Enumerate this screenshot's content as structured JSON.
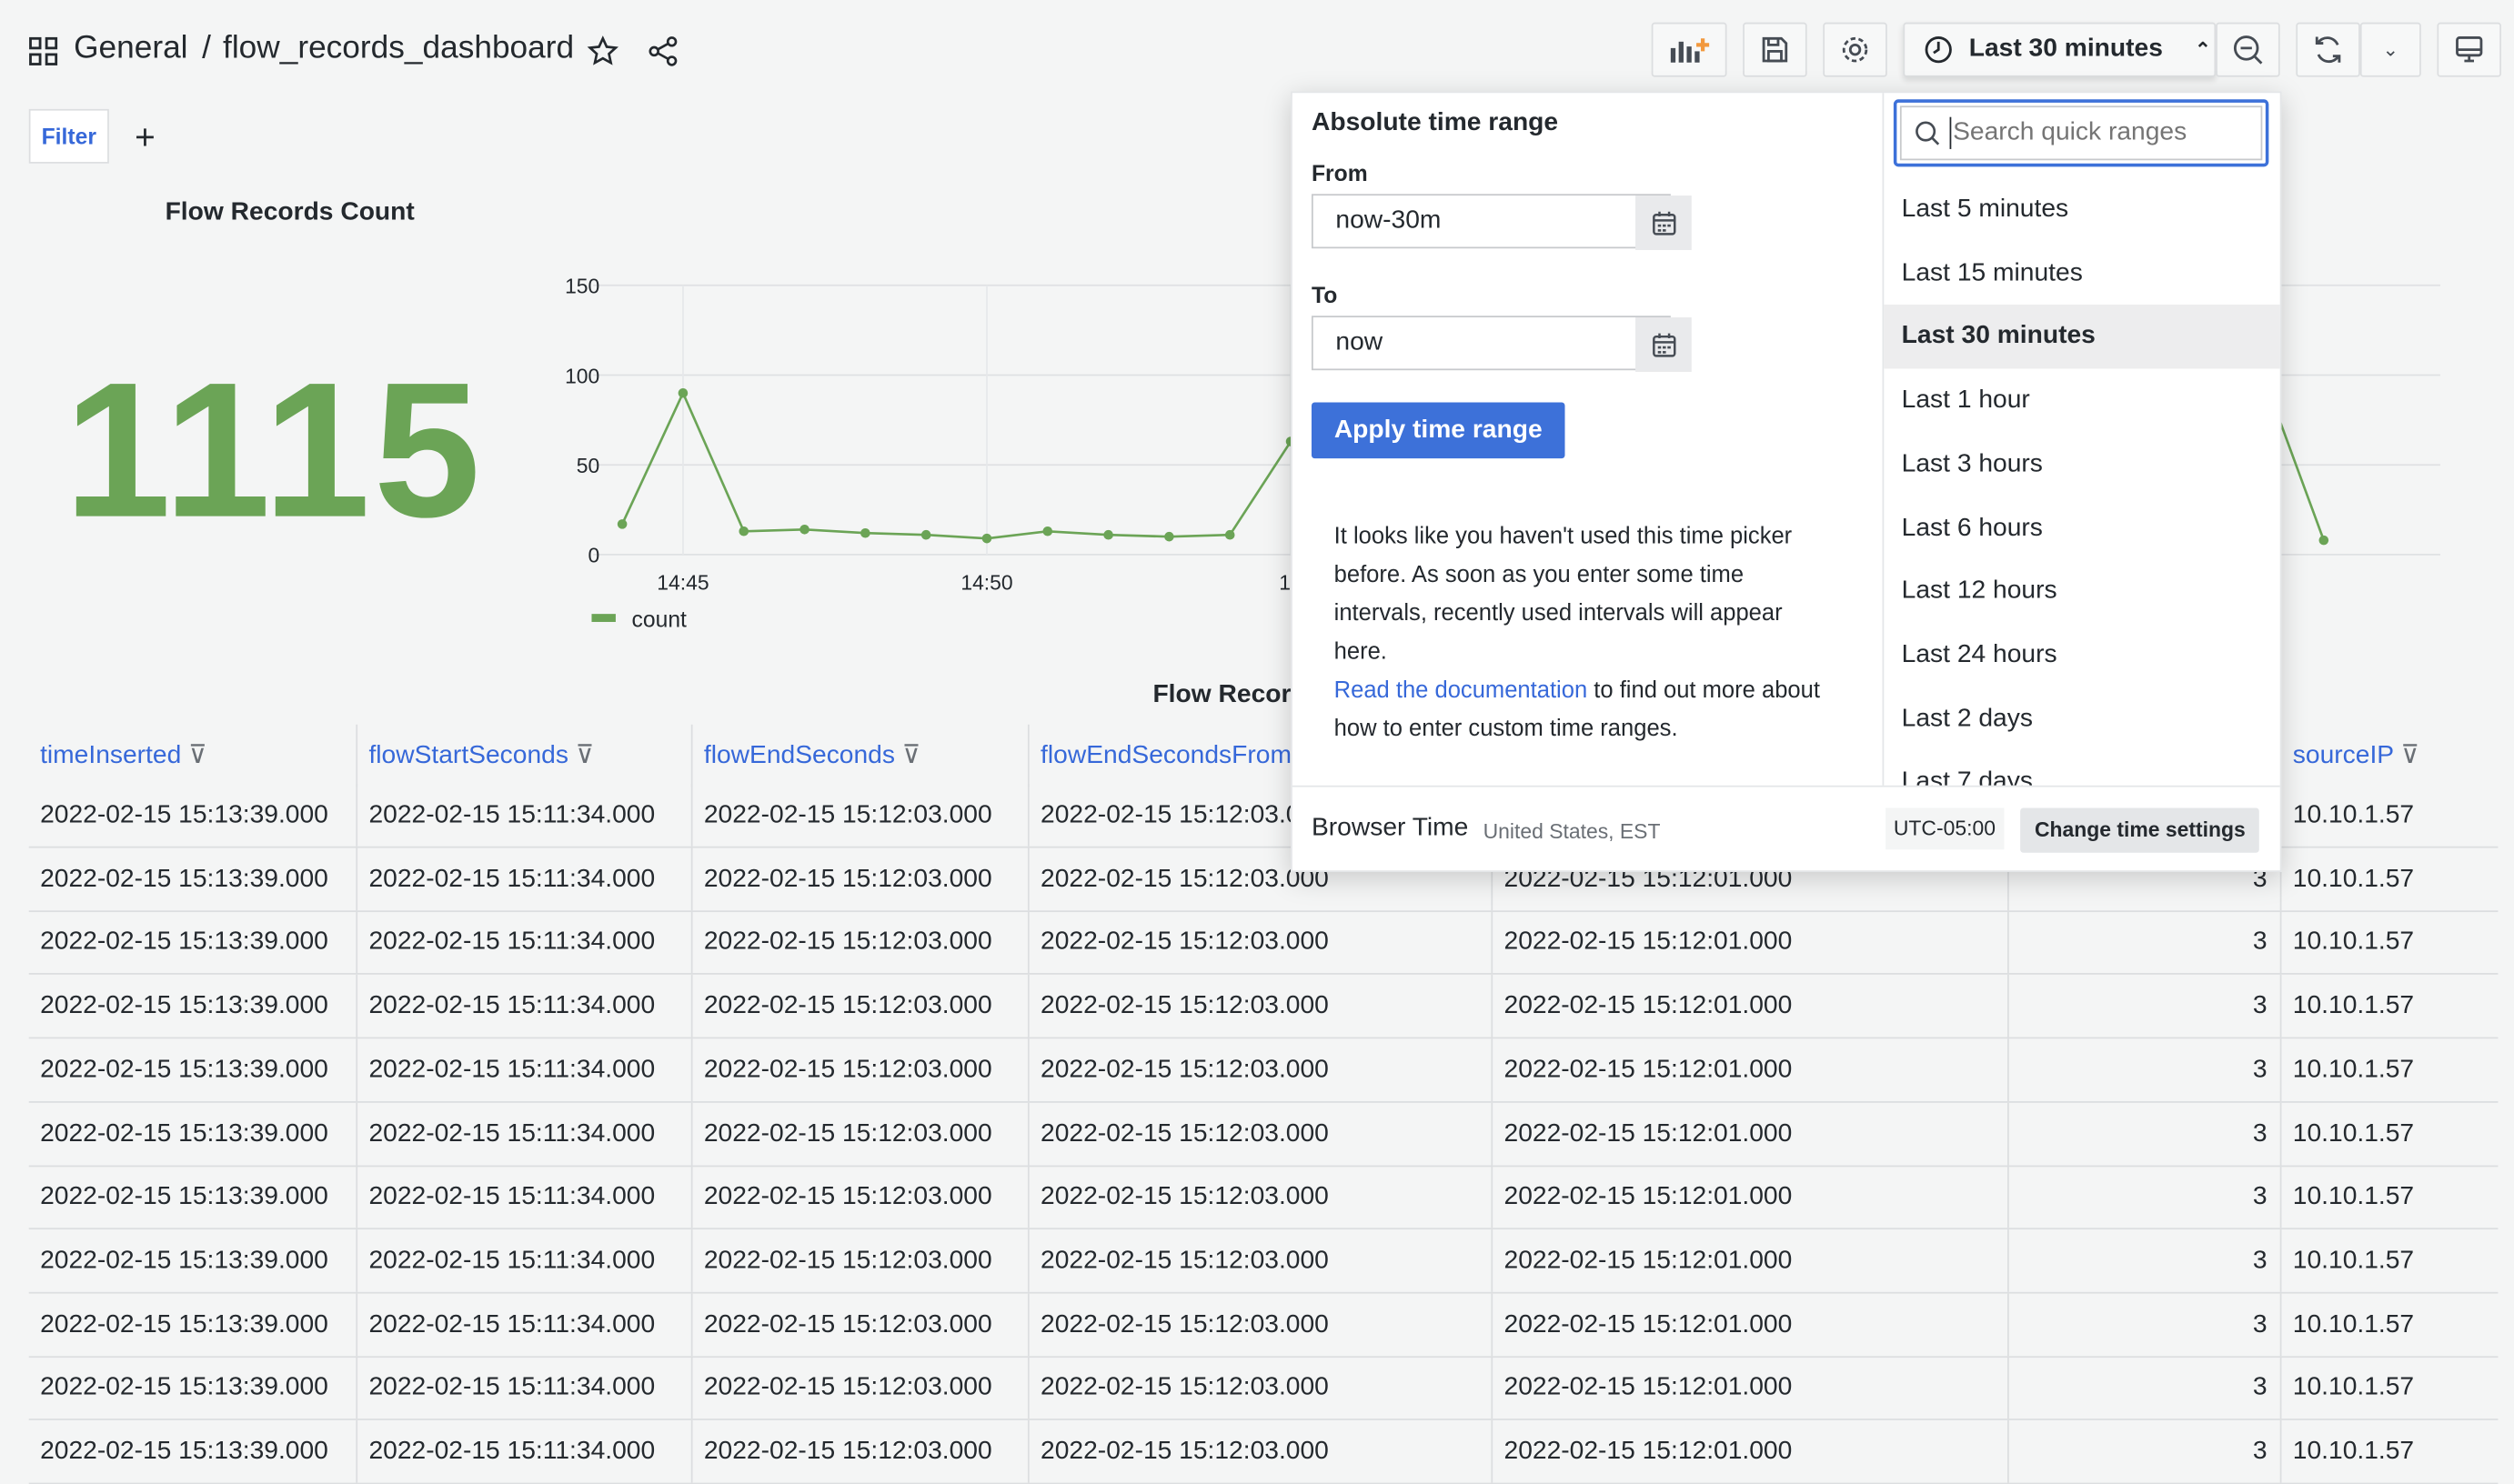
{
  "header": {
    "folder": "General",
    "separator": "/",
    "dashboard": "flow_records_dashboard",
    "time_range_label": "Last 30 minutes"
  },
  "icons": {
    "apps": "grid-icon",
    "star": "star-icon",
    "share": "share-icon",
    "add_panel": "add-panel-icon",
    "save": "save-icon",
    "settings": "gear-icon",
    "clock": "clock-icon",
    "zoom_out": "zoom-out-icon",
    "refresh": "refresh-icon",
    "tv": "tv-icon"
  },
  "filter": {
    "label": "Filter",
    "add": "+"
  },
  "stat": {
    "title": "Flow Records Count",
    "value": "1115",
    "color": "#6ba456"
  },
  "chart_data": {
    "type": "line",
    "x": [
      "14:44",
      "14:45",
      "14:46",
      "14:47",
      "14:48",
      "14:49",
      "14:50",
      "14:51",
      "14:52",
      "14:53",
      "14:54",
      "14:55",
      "15:11",
      "15:12"
    ],
    "series": [
      {
        "name": "count",
        "values": [
          17,
          90,
          13,
          14,
          12,
          11,
          9,
          13,
          11,
          10,
          11,
          63,
          100,
          8
        ]
      }
    ],
    "x_tick_labels": [
      "14:45",
      "14:50",
      "14"
    ],
    "y_ticks": [
      0,
      50,
      100,
      150
    ],
    "ylim": [
      0,
      150
    ],
    "grid": true,
    "legend": "bottom-left",
    "color": "#6ba456"
  },
  "table": {
    "title": "Flow Recor",
    "columns": [
      "timeInserted",
      "flowStartSeconds",
      "flowEndSeconds",
      "flowEndSecondsFrom",
      "",
      "",
      "sourceIP"
    ],
    "row": [
      "2022-02-15 15:13:39.000",
      "2022-02-15 15:11:34.000",
      "2022-02-15 15:12:03.000",
      "2022-02-15 15:12:03.000",
      "2022-02-15 15:12:01.000",
      "3",
      "10.10.1.57"
    ],
    "row_count": 11
  },
  "picker": {
    "absolute_title": "Absolute time range",
    "from_label": "From",
    "from_value": "now-30m",
    "to_label": "To",
    "to_value": "now",
    "apply": "Apply time range",
    "info": "It looks like you haven't used this time picker before. As soon as you enter some time intervals, recently used intervals will appear here.",
    "doc_link": "Read the documentation",
    "doc_rest": " to find out more about how to enter custom time ranges.",
    "search_placeholder": "Search quick ranges",
    "quick_ranges": [
      "Last 5 minutes",
      "Last 15 minutes",
      "Last 30 minutes",
      "Last 1 hour",
      "Last 3 hours",
      "Last 6 hours",
      "Last 12 hours",
      "Last 24 hours",
      "Last 2 days",
      "Last 7 days"
    ],
    "selected": "Last 30 minutes",
    "browser_time": "Browser Time",
    "locale": "United States, EST",
    "utc": "UTC-05:00",
    "change": "Change time settings"
  }
}
